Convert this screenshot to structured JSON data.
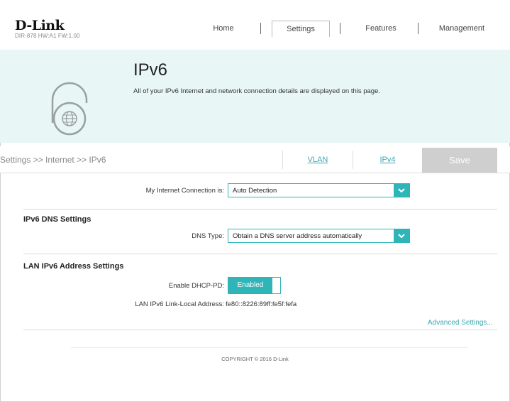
{
  "header": {
    "logo": "D-Link",
    "firmware": "DIR-878 HW:A1 FW:1.00",
    "nav": [
      "Home",
      "Settings",
      "Features",
      "Management"
    ]
  },
  "banner": {
    "title": "IPv6",
    "description": "All of your IPv6 Internet and network connection details are displayed on this page."
  },
  "subbar": {
    "breadcrumb": "Settings >> Internet >> IPv6",
    "vlan": "VLAN",
    "ipv4": "IPv4",
    "save": "Save"
  },
  "connection": {
    "label": "My Internet Connection is:",
    "value": "Auto Detection"
  },
  "dns": {
    "title": "IPv6 DNS Settings",
    "label": "DNS Type:",
    "value": "Obtain a DNS server address automatically"
  },
  "lan": {
    "title": "LAN IPv6 Address Settings",
    "dhcp_label": "Enable DHCP-PD:",
    "dhcp_value": "Enabled",
    "link_local_label": "LAN IPv6 Link-Local Address:",
    "link_local_value": "fe80::8226:89ff:fe5f:fefa"
  },
  "advanced": "Advanced Settings...",
  "copyright": "COPYRIGHT © 2016 D-Link",
  "colors": {
    "accent": "#2fb5b8",
    "banner_bg": "#e8f6f6",
    "save_bg": "#cfcfcf"
  }
}
